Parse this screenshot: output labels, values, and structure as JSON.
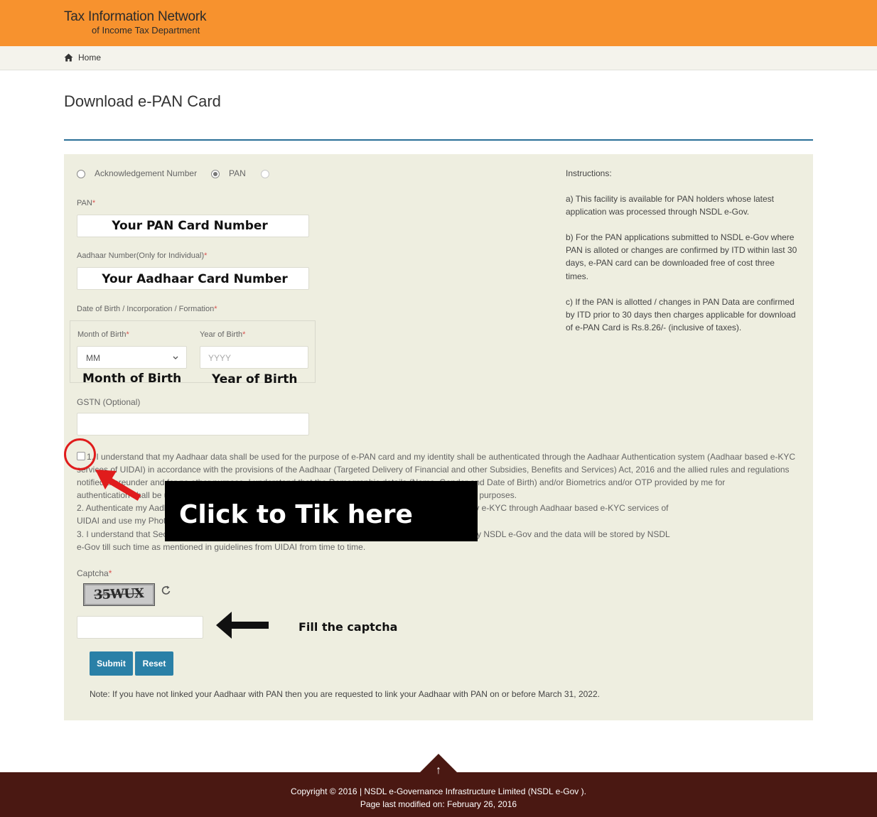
{
  "header": {
    "title": "Tax Information Network",
    "subtitle": "of Income Tax Department"
  },
  "breadcrumb": {
    "home_label": "Home"
  },
  "page": {
    "title": "Download e-PAN Card"
  },
  "form": {
    "radio_options": [
      {
        "label": "Acknowledgement Number",
        "selected": false
      },
      {
        "label": "PAN",
        "selected": true
      },
      {
        "label": "",
        "selected": false
      }
    ],
    "pan_label": "PAN",
    "pan_value": "Your PAN Card Number",
    "aadhaar_label": "Aadhaar Number(Only for Individual)",
    "aadhaar_value": "Your Aadhaar Card Number",
    "dob_label": "Date of Birth / Incorporation / Formation",
    "month_label": "Month of Birth",
    "month_value": "MM",
    "month_annotation": "Month of Birth",
    "year_label": "Year of Birth",
    "year_placeholder": "YYYY",
    "year_annotation": "Year of Birth",
    "gstn_label": "GSTN (Optional)",
    "gstn_value": "",
    "required_mark": "*",
    "consent_lines": [
      "1. I understand that my Aadhaar data shall be used for the purpose of e-PAN card and my identity shall be authenticated through the Aadhaar Authentication system (Aadhaar based e-KYC",
      "services of UIDAI) in accordance with the provisions of the Aadhaar (Targeted Delivery of Financial and other Subsidies, Benefits and Services) Act, 2016 and the allied rules and regulations",
      "notified thereunder and for no other purpose. I understand that the Demographic details (Name, Gender and Date of Birth) and/or Biometrics and/or OTP provided by me for",
      "authentication shall be used only for authenticating my identity for this specific transaction and for no other purposes.",
      "2. Authenticate my Aadhaar number through Aadhaar based e-KYC Authentication system for obtaining my e-KYC through Aadhaar based e-KYC services of",
      "UIDAI and use my Photo and Demographic details for the purpose of the PAN application.",
      "3. I understand that Security and confidentiality of personal identity data based authentication is ensured by NSDL e-Gov and the data will be stored by NSDL",
      "e-Gov till such time as mentioned in guidelines from UIDAI from time to time."
    ],
    "captcha_label": "Captcha",
    "captcha_image_text": "35WUX",
    "captcha_input_value": "",
    "submit_label": "Submit",
    "reset_label": "Reset",
    "note": "Note: If you have not linked your Aadhaar with PAN then you are requested to link your Aadhaar with PAN on or before March 31, 2022."
  },
  "annotations": {
    "tik_here": "Click to Tik here",
    "fill_captcha": "Fill the captcha",
    "highlight_color": "#e01c1c"
  },
  "instructions": {
    "heading": "Instructions:",
    "item_a": [
      "a) This facility is available for PAN holders whose latest",
      "application was processed through NSDL e-Gov."
    ],
    "item_b": [
      "b) For the PAN applications submitted to NSDL e-Gov where",
      "PAN is alloted or changes are confirmed by ITD within last 30",
      "days, e-PAN card can be downloaded free of cost three",
      "times."
    ],
    "item_c": [
      "c) If the PAN is allotted / changes in PAN Data are confirmed",
      "by ITD prior to 30 days then charges applicable for download",
      "of e-PAN Card is Rs.8.26/- (inclusive of taxes)."
    ]
  },
  "footer": {
    "copyright": "Copyright © 2016 | NSDL e-Governance Infrastructure Limited (NSDL e-Gov ).",
    "modified": "Page last modified on: February 26, 2016"
  },
  "colors": {
    "header_bg": "#f7922e",
    "footer_bg": "#4a1812",
    "button_bg": "#2a80a7",
    "panel_bg": "#eeeee0",
    "rule": "#2a6f97"
  }
}
